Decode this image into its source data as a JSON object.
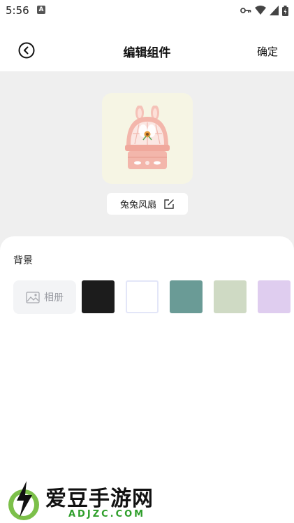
{
  "status_bar": {
    "time": "5:56",
    "notification_badge": "A"
  },
  "header": {
    "title": "编辑组件",
    "confirm_label": "确定"
  },
  "preview": {
    "widget_name": "兔兔风扇",
    "card_color": "#f6f5e4"
  },
  "background_section": {
    "label": "背景",
    "album_label": "相册",
    "swatches": [
      "#1c1c1c",
      "#ffffff",
      "#6a9b96",
      "#cfdac4",
      "#dfcdef"
    ]
  },
  "watermark": {
    "title": "爱豆手游网",
    "subtitle": "ADJZC.COM"
  }
}
